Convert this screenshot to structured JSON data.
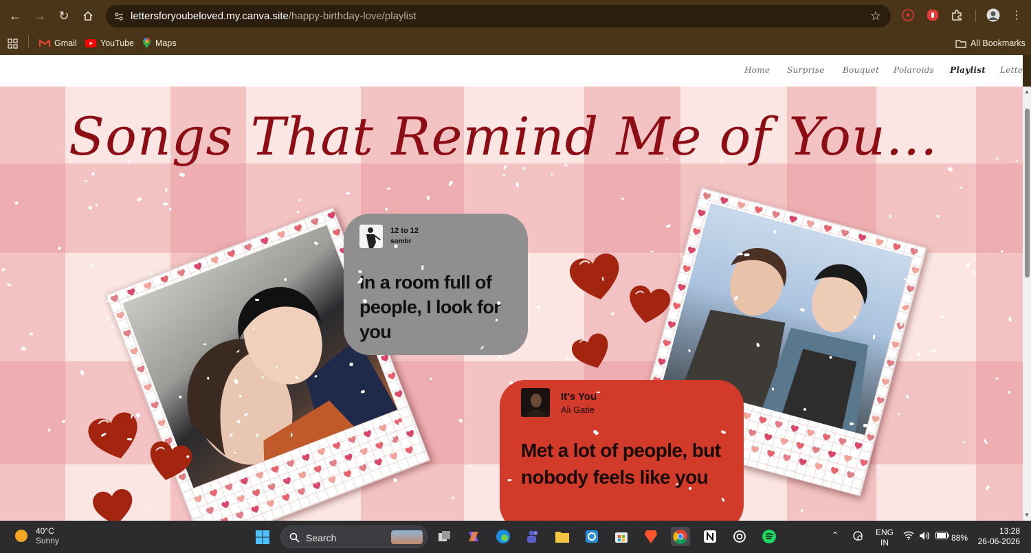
{
  "browser": {
    "url_host": "lettersforyoubeloved.my.canva.site",
    "url_path": "/happy-birthday-love/playlist",
    "bookmarks": [
      {
        "label": "Gmail",
        "icon": "gmail-icon"
      },
      {
        "label": "YouTube",
        "icon": "youtube-icon"
      },
      {
        "label": "Maps",
        "icon": "maps-icon"
      }
    ],
    "all_bookmarks_label": "All Bookmarks"
  },
  "site_nav": {
    "items": [
      "Home",
      "Surprise",
      "Bouquet",
      "Polaroids",
      "Playlist",
      "Letter"
    ],
    "active": "Playlist"
  },
  "page": {
    "headline": "Songs That Remind Me of You...",
    "songs": [
      {
        "title": "12 to 12",
        "artist": "sombr",
        "lyric": "In a room full of people, I look for you",
        "bubble_color": "#8f8f8f",
        "text_color": "#111111"
      },
      {
        "title": "It's You",
        "artist": "Ali Gatie",
        "lyric": "Met a lot of people, but nobody feels like you",
        "bubble_color": "#d23a2a",
        "text_color": "#1a0a06"
      }
    ],
    "colors": {
      "headline": "#8d0d14",
      "heart": "#a3240f",
      "background": "#fbe6e3"
    }
  },
  "taskbar": {
    "weather_temp": "40°C",
    "weather_cond": "Sunny",
    "search_label": "Search",
    "language_line1": "ENG",
    "language_line2": "IN",
    "battery": "88%",
    "time": "13:28",
    "date": "26-06-2026"
  }
}
